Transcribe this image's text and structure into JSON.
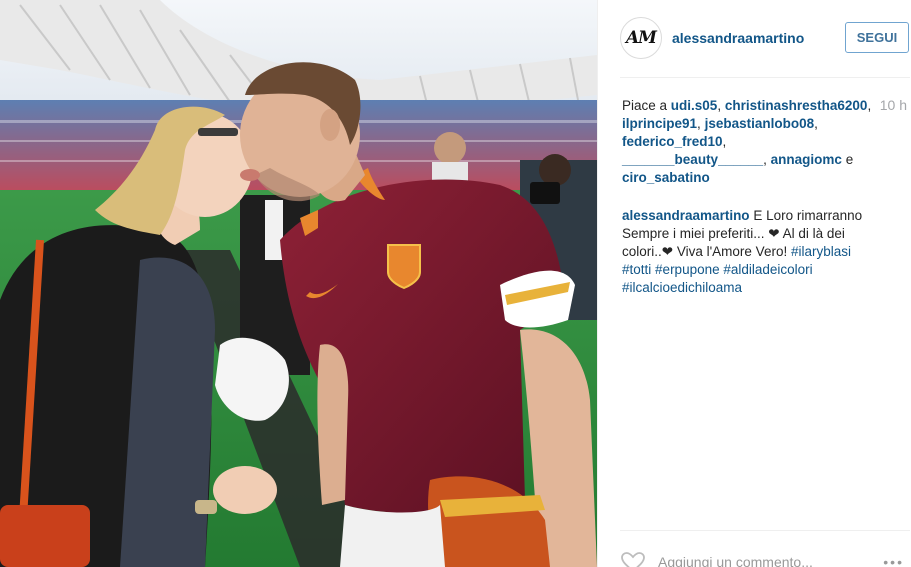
{
  "post": {
    "username": "alessandraamartino",
    "follow_label": "SEGUI",
    "avatar_text": "AM",
    "time_ago": "10 h"
  },
  "likes": {
    "prefix": "Piace a",
    "users": [
      "udi.s05",
      "christinashrestha6200",
      "ilprincipe91",
      "jsebastianlobo08",
      "federico_fred10",
      "_______beauty______",
      "annagiomc",
      "ciro_sabatino"
    ],
    "separator": ",",
    "conjunction": "e"
  },
  "caption": {
    "author": "alessandraamartino",
    "text": "E Loro rimarranno Sempre i miei preferiti... ❤ Al di là dei colori..❤ Viva l'Amore Vero!",
    "hashtags": [
      "#ilaryblasi",
      "#totti",
      "#erpupone",
      "#aldiladeicolori",
      "#ilcalcioedichiloama"
    ]
  },
  "comment_bar": {
    "placeholder": "Aggiungi un commento...",
    "more_icon": "ellipsis-icon",
    "like_icon": "heart-icon"
  },
  "photo": {
    "description_icon": "post-photo",
    "colors": {
      "jersey": "#7a1a2c",
      "jersey_trim": "#e8872e",
      "pitch": "#2f8a3b",
      "sky": "#e8eef4"
    }
  },
  "colors": {
    "link": "#125688",
    "follow_border": "#70a4d0",
    "follow_text": "#3f729b",
    "muted": "#a5a7aa"
  }
}
